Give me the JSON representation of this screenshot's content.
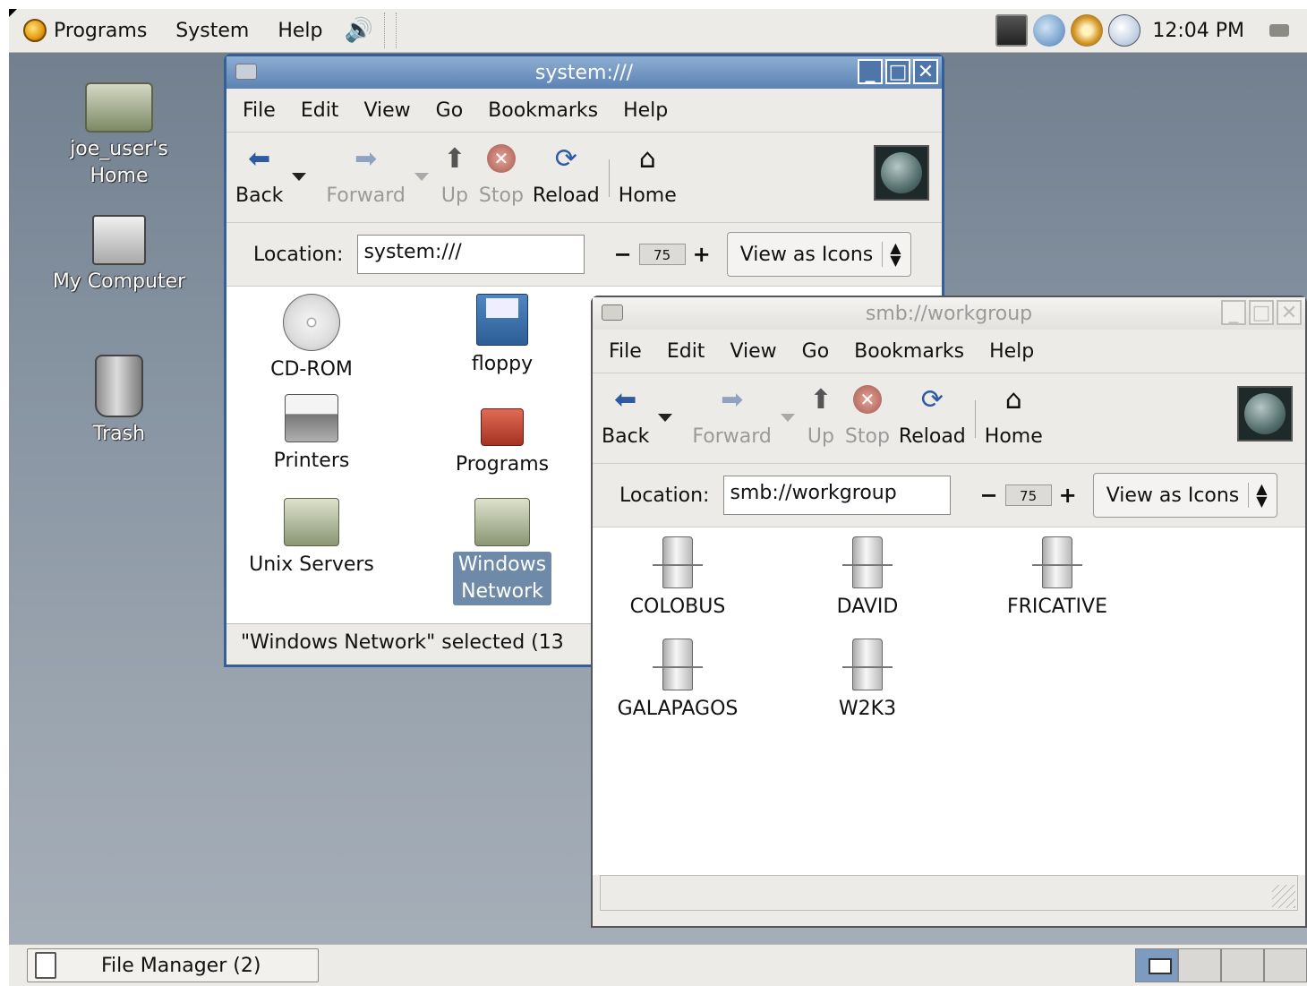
{
  "panel": {
    "menus": [
      "Programs",
      "System",
      "Help"
    ],
    "clock": "12:04 PM",
    "tray_icons": [
      "terminal-icon",
      "globe-icon",
      "gear-icon",
      "pen-icon"
    ]
  },
  "desktop": {
    "icons": [
      {
        "label_line1": "joe_user's",
        "label_line2": "Home",
        "icon": "home-folder-icon"
      },
      {
        "label": "My Computer",
        "icon": "computer-icon"
      },
      {
        "label": "Trash",
        "icon": "trash-icon"
      }
    ]
  },
  "window1": {
    "title": "system:///",
    "menu": [
      "File",
      "Edit",
      "View",
      "Go",
      "Bookmarks",
      "Help"
    ],
    "toolbar": {
      "back": "Back",
      "forward": "Forward",
      "up": "Up",
      "stop": "Stop",
      "reload": "Reload",
      "home": "Home"
    },
    "location_label": "Location:",
    "location": "system:///",
    "zoom": "75",
    "view_mode": "View as Icons",
    "items": [
      {
        "label": "CD-ROM",
        "icon": "cdrom-icon"
      },
      {
        "label": "floppy",
        "icon": "floppy-icon"
      },
      {
        "label": "Printers",
        "icon": "printer-icon"
      },
      {
        "label": "Programs",
        "icon": "programs-icon"
      },
      {
        "label": "Unix Servers",
        "icon": "network-folder-icon"
      },
      {
        "label_line1": "Windows",
        "label_line2": "Network",
        "icon": "network-folder-icon",
        "selected": true
      }
    ],
    "status": "\"Windows Network\" selected (13"
  },
  "window2": {
    "title": "smb://workgroup",
    "menu": [
      "File",
      "Edit",
      "View",
      "Go",
      "Bookmarks",
      "Help"
    ],
    "toolbar": {
      "back": "Back",
      "forward": "Forward",
      "up": "Up",
      "stop": "Stop",
      "reload": "Reload",
      "home": "Home"
    },
    "location_label": "Location:",
    "location": "smb://workgroup",
    "zoom": "75",
    "view_mode": "View as Icons",
    "servers": [
      "COLOBUS",
      "DAVID",
      "FRICATIVE",
      "GALAPAGOS",
      "W2K3"
    ],
    "status": ""
  },
  "taskbar": {
    "task": "File Manager (2)"
  }
}
